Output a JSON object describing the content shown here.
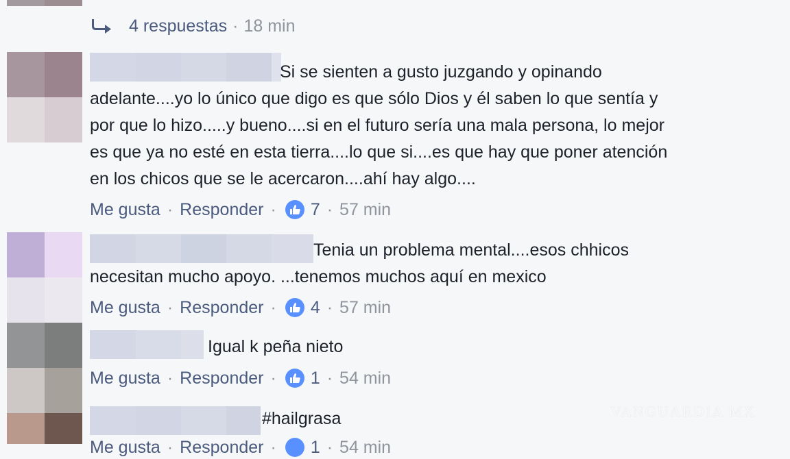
{
  "replies_link": {
    "label": "4 respuestas",
    "separator": "·",
    "time": "18 min"
  },
  "comments": [
    {
      "text": "Si se sienten a gusto juzgando y opinando\nadelante....yo lo único que digo es que sólo Dios y él saben lo que sentía y\npor que lo hizo.....y bueno....si en el futuro sería una mala persona, lo mejor\nes que ya no esté en esta tierra....lo que si....es que hay que poner atención\nen los chicos que se le acercaron....ahí hay algo....",
      "like_label": "Me gusta",
      "reply_label": "Responder",
      "separator": "·",
      "like_count": "7",
      "time": "57 min"
    },
    {
      "text": "Tenia un problema mental....esos chhicos\nnecesitan mucho apoyo. ...tenemos muchos aquí en mexico",
      "like_label": "Me gusta",
      "reply_label": "Responder",
      "separator": "·",
      "like_count": "4",
      "time": "57 min"
    },
    {
      "text": "Igual k peña nieto",
      "like_label": "Me gusta",
      "reply_label": "Responder",
      "separator": "·",
      "like_count": "1",
      "time": "54 min"
    },
    {
      "text": "#hailgrasa",
      "like_label": "Me gusta",
      "reply_label": "Responder",
      "separator": "·",
      "like_count": "1",
      "time": "54 min"
    }
  ],
  "watermark": "VANGUARDIA MX",
  "colors": {
    "link": "#4b5b7e",
    "meta": "#90949c",
    "text": "#1d2129",
    "like_blue": "#5890ff",
    "background": "#f6f7f9"
  },
  "icons": {
    "reply_arrow": "reply-arrow-icon",
    "like": "thumbs-up-icon"
  }
}
